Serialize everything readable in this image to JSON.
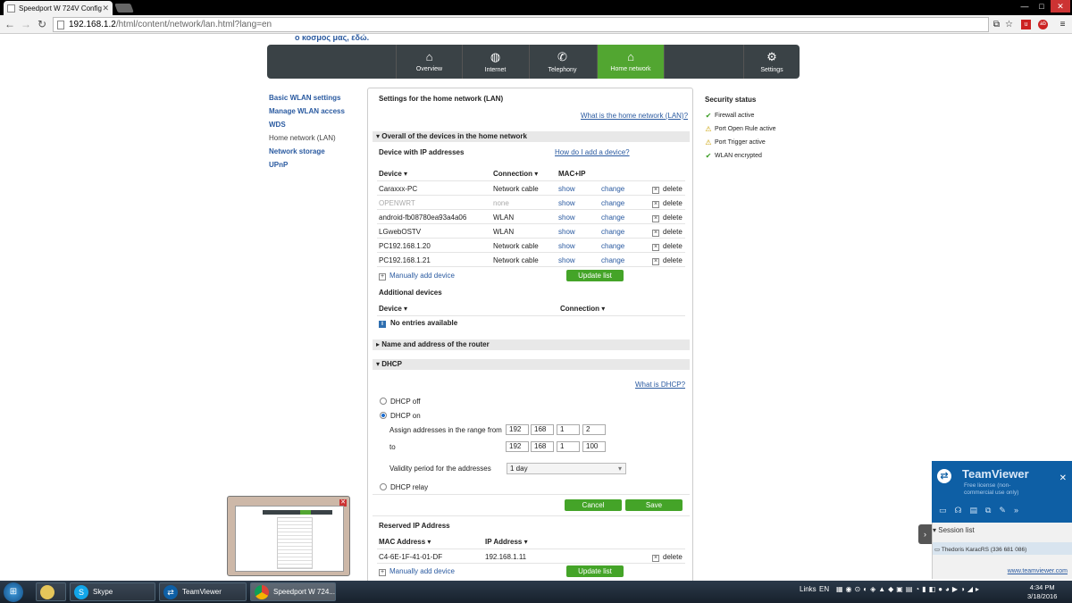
{
  "browser": {
    "tab_title": "Speedport W 724V Config",
    "url_host": "192.168.1.2",
    "url_path": "/html/content/network/lan.html?lang=en"
  },
  "page": {
    "greek_text": "ο κοσμος μας, εδώ.",
    "nav": [
      {
        "label": "Overview",
        "icon": "house-icon"
      },
      {
        "label": "Internet",
        "icon": "globe-icon"
      },
      {
        "label": "Telephony",
        "icon": "phone-icon"
      },
      {
        "label": "Home network",
        "icon": "home-network-icon"
      },
      {
        "label": "Settings",
        "icon": "gear-icon"
      }
    ],
    "sidebar": [
      "Basic WLAN settings",
      "Manage WLAN access",
      "WDS",
      "Home network (LAN)",
      "Network storage",
      "UPnP"
    ],
    "panel_title": "Settings for the home network (LAN)",
    "help_lan": "What is the home network (LAN)?",
    "section_overall": "Overall of the devices in the home network",
    "devices_ip_title": "Device with IP addresses",
    "how_add": "How do I add a device?",
    "col_device": "Device",
    "col_connection": "Connection",
    "col_macip": "MAC+IP",
    "devices": [
      {
        "name": "Caraxxx-PC",
        "conn": "Network cable"
      },
      {
        "name": "OPENWRT",
        "conn": "none"
      },
      {
        "name": "android-fb08780ea93a4a06",
        "conn": "WLAN"
      },
      {
        "name": "LGwebOSTV",
        "conn": "WLAN"
      },
      {
        "name": "PC192.168.1.20",
        "conn": "Network cable"
      },
      {
        "name": "PC192.168.1.21",
        "conn": "Network cable"
      }
    ],
    "show": "show",
    "change": "change",
    "delete": "delete",
    "manually_add": "Manually add device",
    "update_list": "Update list",
    "additional_title": "Additional devices",
    "no_entries": "No entries available",
    "section_router": "Name and address of the router",
    "section_dhcp": "DHCP",
    "what_dhcp": "What is DHCP?",
    "dhcp_off": "DHCP off",
    "dhcp_on": "DHCP on",
    "range_from": "Assign addresses in the range from",
    "range_to": "to",
    "ip_from": [
      "192",
      "168",
      "1",
      "2"
    ],
    "ip_to": [
      "192",
      "168",
      "1",
      "100"
    ],
    "validity_label": "Validity period for the addresses",
    "validity_value": "1 day",
    "dhcp_relay": "DHCP relay",
    "cancel": "Cancel",
    "save": "Save",
    "reserved_title": "Reserved IP Address",
    "col_mac": "MAC Address",
    "col_ip": "IP Address",
    "reserved_mac": "C4-6E-1F-41-01-DF",
    "reserved_ip": "192.168.1.11",
    "security_title": "Security status",
    "security": [
      {
        "text": "Firewall active",
        "status": "ok"
      },
      {
        "text": "Port Open Rule active",
        "status": "warn"
      },
      {
        "text": "Port Trigger active",
        "status": "warn"
      },
      {
        "text": "WLAN encrypted",
        "status": "ok"
      }
    ]
  },
  "teamviewer": {
    "name": "TeamViewer",
    "license": "Free license (non-commercial use only)",
    "session_list": "Session list",
    "session": "Thedoris KaracRS (336 681 086)",
    "url": "www.teamviewer.com"
  },
  "taskbar": {
    "items": [
      "Skype",
      "TeamViewer",
      "Speedport W 724..."
    ],
    "links": "Links",
    "lang": "EN",
    "time": "4:34 PM",
    "date": "3/18/2016"
  }
}
